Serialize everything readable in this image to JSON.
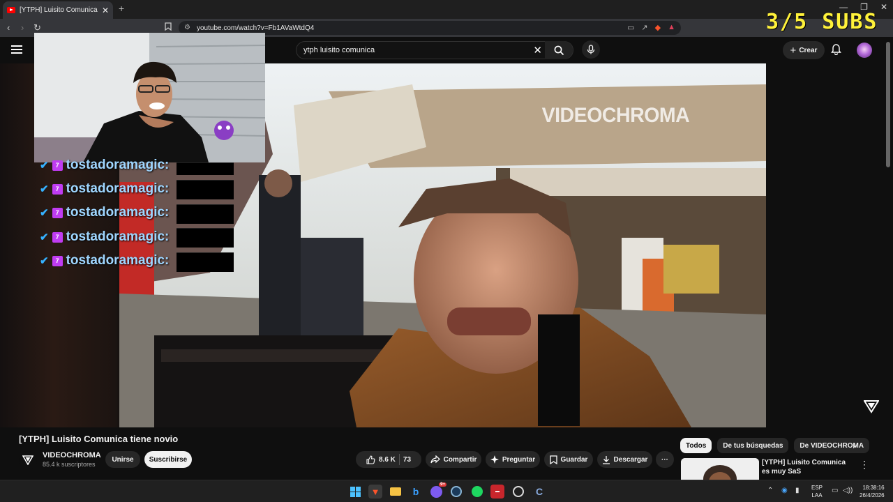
{
  "browser": {
    "tab_title": "[YTPH] Luisito Comunica tiene",
    "tab_close": "✕",
    "new_tab": "+",
    "window_controls": [
      "—",
      "❐",
      "✕"
    ],
    "back": "‹",
    "forward": "›",
    "reload": "↻",
    "url": "youtube.com/watch?v=Fb1AVaWtdQ4"
  },
  "overlay": {
    "subs_counter": "3/5 SUBS",
    "chat_username": "tostadoramagic:",
    "chat_rows": [
      "tostadoramagic:",
      "tostadoramagic:",
      "tostadoramagic:",
      "tostadoramagic:",
      "tostadoramagic:"
    ]
  },
  "header": {
    "search_value": "ytph luisito comunica",
    "create_label": "Crear"
  },
  "video": {
    "watermark": "VIDEOCHROMA",
    "title": "[YTPH] Luisito Comunica tiene novio"
  },
  "channel": {
    "name": "VIDEOCHROMA",
    "subscribers": "85.4 k suscriptores",
    "join_label": "Unirse",
    "subscribe_label": "Suscribirse"
  },
  "actions": {
    "likes": "8.6 K",
    "dislikes": "73",
    "share": "Compartir",
    "ask": "Preguntar",
    "save": "Guardar",
    "download": "Descargar",
    "more": "···"
  },
  "sidebar": {
    "chips": [
      "Todos",
      "De tus búsquedas",
      "De VIDEOCHROMA"
    ],
    "rec_title": "[YTPH] Luisito Comunica es muy SaS"
  },
  "taskbar": {
    "lang_top": "ESP",
    "lang_bottom": "LAA",
    "time": "18:38:16",
    "date": "26/4/2026",
    "discord_badge": "9+"
  },
  "colors": {
    "accent_red": "#ff0000",
    "subs_yellow": "#fff23a",
    "chat_name": "#9fd6ff",
    "twitch_purple": "#c03cf2"
  }
}
